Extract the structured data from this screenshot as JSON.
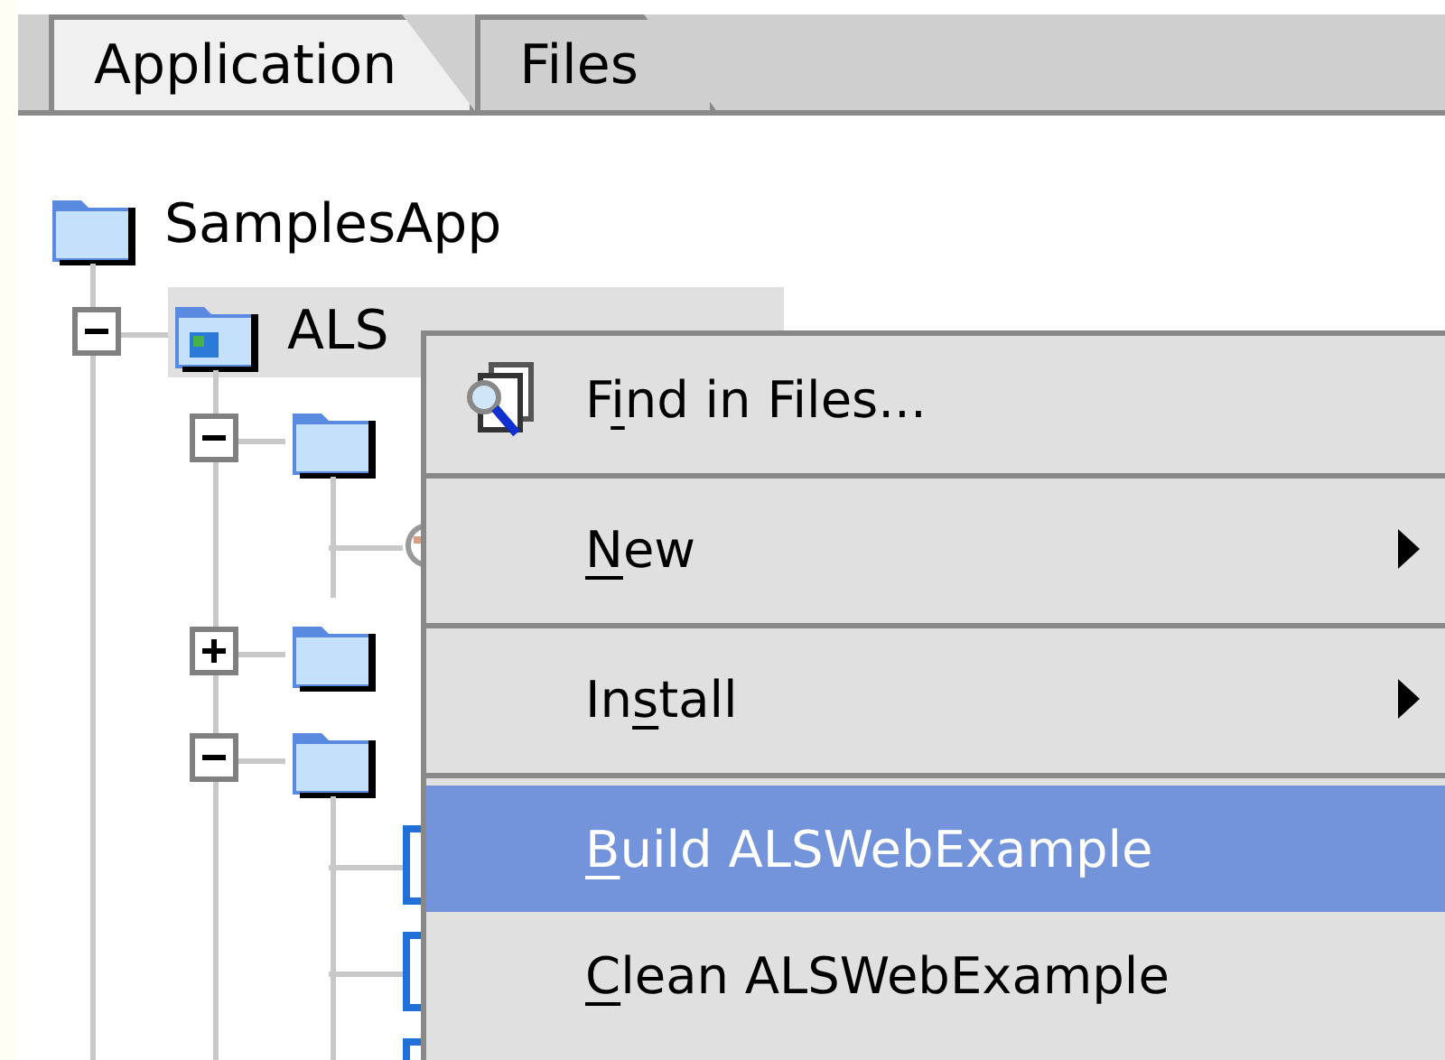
{
  "tabs": [
    {
      "label": "Application",
      "selected": true
    },
    {
      "label": "Files",
      "selected": false
    }
  ],
  "tree": [
    {
      "label": "SamplesApp",
      "kind": "folder",
      "selected": false,
      "children": [
        {
          "label": "ALS",
          "kind": "project",
          "expanded": true,
          "selected": true,
          "children": [
            {
              "kind": "folder",
              "expanded": true,
              "children": [
                {
                  "kind": "web"
                }
              ]
            },
            {
              "kind": "folder",
              "expanded": false
            },
            {
              "kind": "folder",
              "expanded": true,
              "children": [
                {
                  "kind": "file"
                },
                {
                  "kind": "file"
                },
                {
                  "kind": "file"
                }
              ]
            }
          ]
        }
      ]
    }
  ],
  "menu": [
    {
      "pre": "F",
      "key": "i",
      "post": "nd in Files...",
      "kind": "find",
      "submenu": false,
      "selected": false
    },
    {
      "key": "N",
      "post": "ew",
      "submenu": true,
      "selected": false
    },
    {
      "pre": "In",
      "key": "s",
      "post": "tall",
      "submenu": true,
      "selected": false
    },
    {
      "key": "B",
      "post": "uild ALSWebExample",
      "submenu": false,
      "selected": true
    },
    {
      "key": "C",
      "post": "lean ALSWebExample",
      "submenu": false,
      "selected": false
    }
  ]
}
